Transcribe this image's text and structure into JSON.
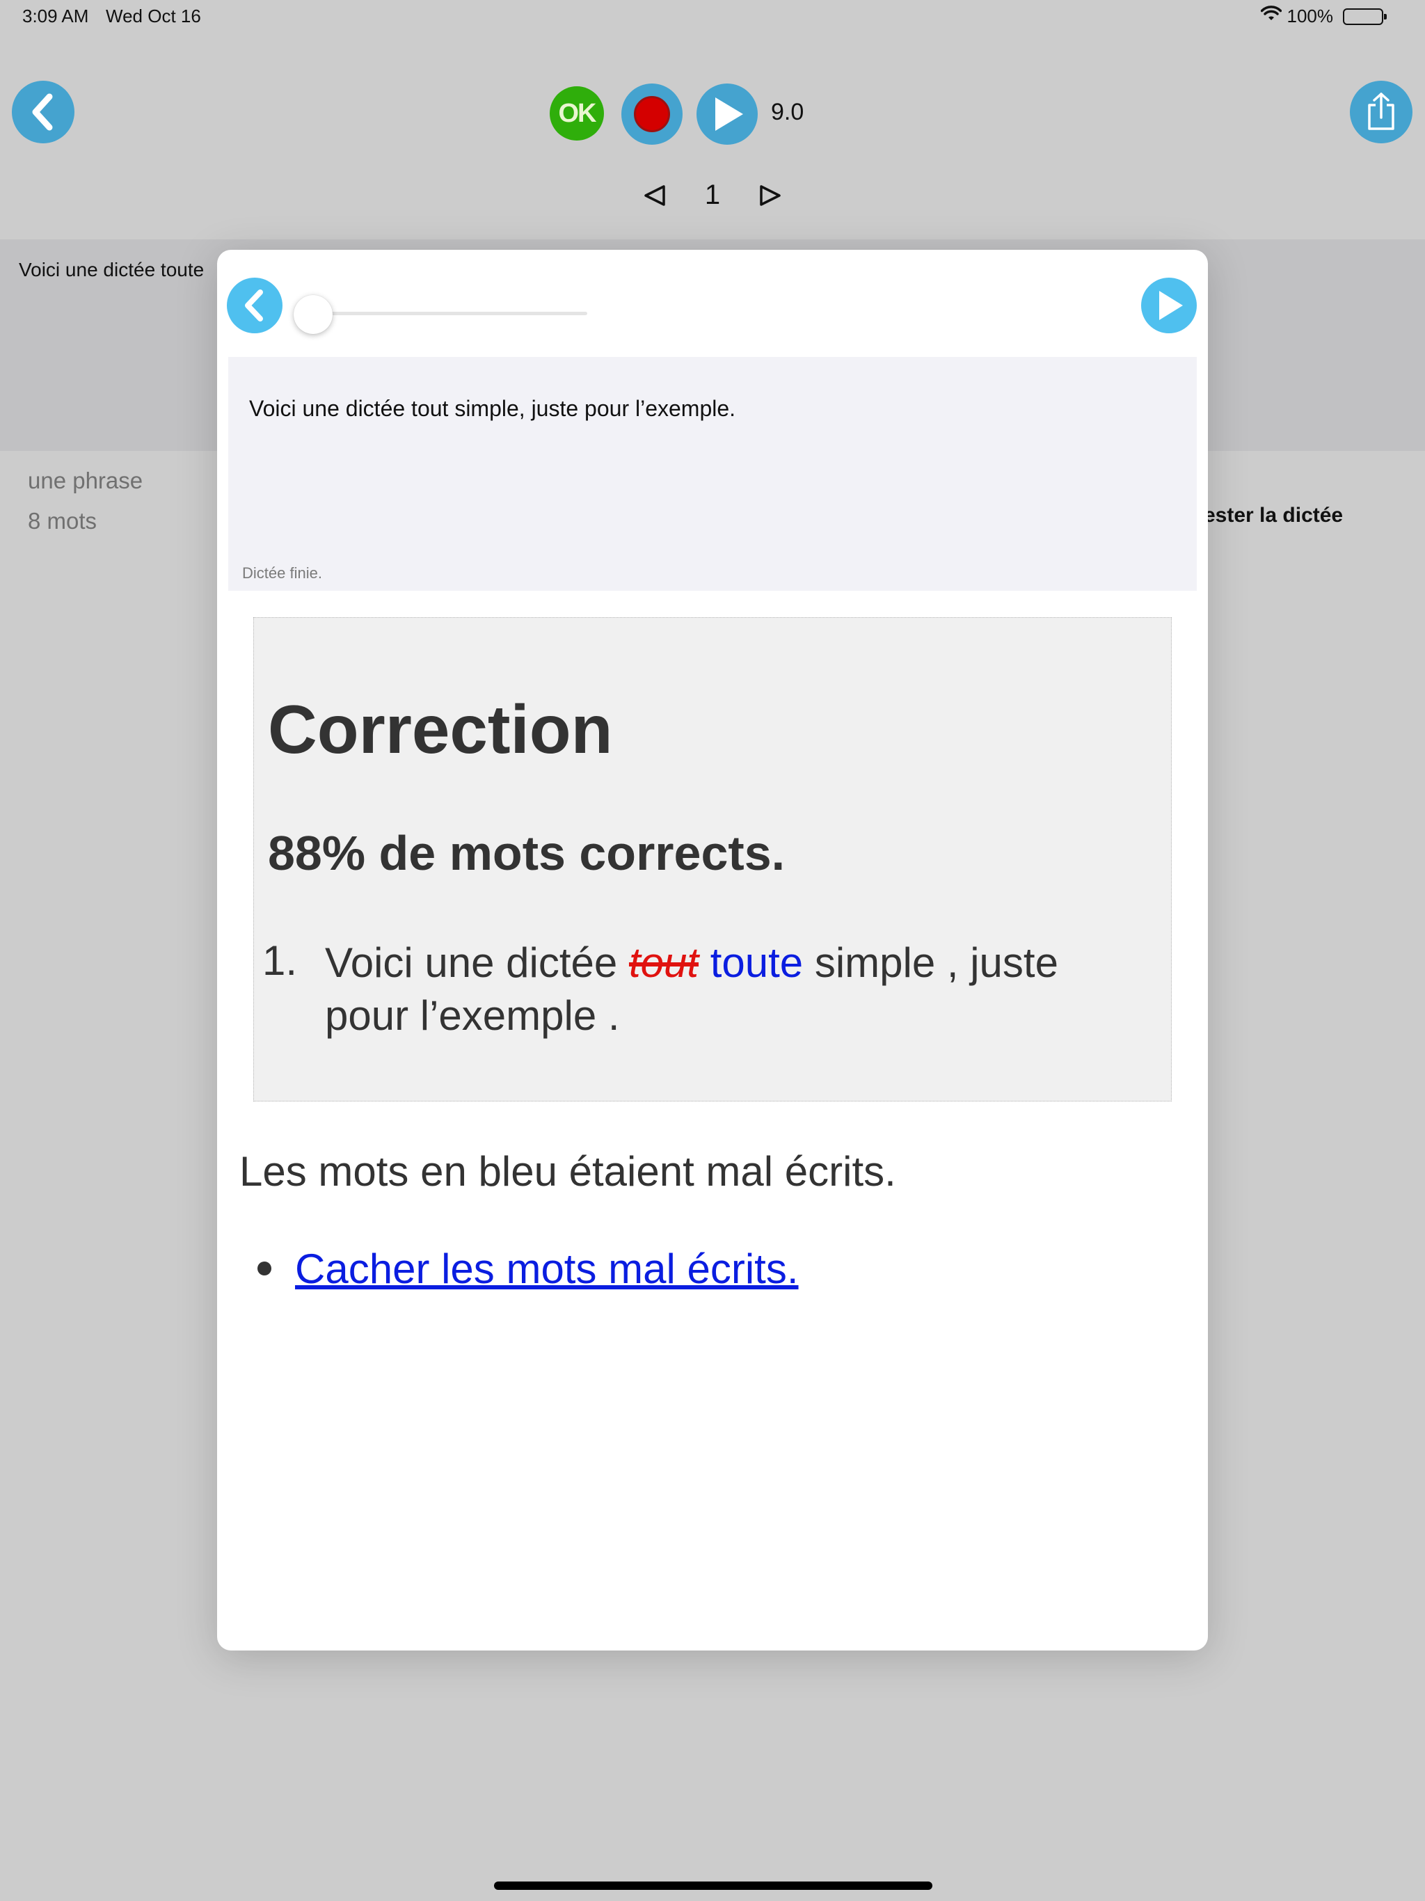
{
  "status_bar": {
    "time": "3:09 AM",
    "date": "Wed Oct 16",
    "battery": "100%",
    "icons": [
      "wifi-icon",
      "battery-icon"
    ]
  },
  "toolbar": {
    "ok_label": "OK",
    "speed": "9.0",
    "page_number": "1",
    "icons": [
      "back-chevron-icon",
      "record-icon",
      "play-icon",
      "share-icon",
      "prev-triangle-icon",
      "next-triangle-icon"
    ]
  },
  "background": {
    "dictation_preview": "Voici une dictée toute",
    "subtitle": "une phrase",
    "word_count": "8 mots",
    "test_action": "ester la dictée"
  },
  "modal": {
    "slider_position": 0,
    "dictation_text": "Voici une dictée tout simple, juste pour l’exemple.",
    "dictation_status": "Dictée finie.",
    "correction": {
      "title": "Correction",
      "score": "88% de mots corrects.",
      "item_number": "1.",
      "segments": {
        "before": "Voici une dictée ",
        "wrong": "tout",
        "right": "toute",
        "after": " simple , juste pour l’exemple ."
      }
    },
    "info": "Les mots en bleu étaient mal écrits.",
    "hide_link": "Cacher les mots mal écrits."
  },
  "colors": {
    "accent_blue": "#45a3cf",
    "modal_button_blue": "#4fc0ef",
    "ok_green": "#2fae0b",
    "record_red": "#d40000",
    "wrong_word": "#e0120f",
    "corrected_word": "#0a1de0"
  }
}
